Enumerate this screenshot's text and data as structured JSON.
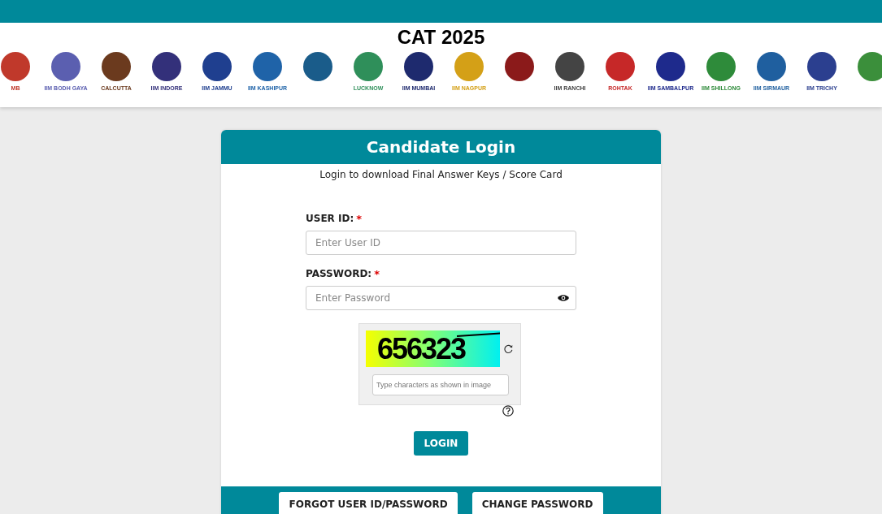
{
  "header": {
    "title": "CAT 2025",
    "logos": [
      {
        "label": "MB",
        "color": "#c0392b"
      },
      {
        "label": "IIM BODH GAYA",
        "color": "#5b5fb0"
      },
      {
        "label": "CALCUTTA",
        "color": "#6b3a1e"
      },
      {
        "label": "IIM INDORE",
        "color": "#33307a"
      },
      {
        "label": "IIM JAMMU",
        "color": "#1f3f8f"
      },
      {
        "label": "IIM KASHIPUR",
        "color": "#1f63a8"
      },
      {
        "color": "#1a5c8a"
      },
      {
        "label": "LUCKNOW",
        "color": "#2f8f5a"
      },
      {
        "label": "IIM MUMBAI",
        "color": "#1e2a6e"
      },
      {
        "label": "IIM NAGPUR",
        "color": "#d4a017"
      },
      {
        "color": "#8b1a1a"
      },
      {
        "label": "IIM RANCHI",
        "color": "#444444"
      },
      {
        "label": "ROHTAK",
        "color": "#c62828"
      },
      {
        "label": "IIM SAMBALPUR",
        "color": "#1e2a8c"
      },
      {
        "label": "IIM SHILLONG",
        "color": "#2e8b3a"
      },
      {
        "label": "IIM SIRMAUR",
        "color": "#1f5f9f"
      },
      {
        "label": "IIM TRICHY",
        "color": "#2b3f8f"
      },
      {
        "color": "#3b8f3b"
      }
    ]
  },
  "login": {
    "title": "Candidate Login",
    "subtitle": "Login to download Final Answer Keys / Score Card",
    "fields": [
      {
        "kind": "text",
        "label": "USER ID:",
        "required_mark": "*",
        "placeholder": "Enter User ID"
      },
      {
        "kind": "password",
        "label": "PASSWORD:",
        "required_mark": "*",
        "placeholder": "Enter Password"
      }
    ],
    "captcha": {
      "code": "656323",
      "placeholder": "Type characters as shown in image"
    },
    "submit": "LOGIN",
    "footer_buttons": [
      "FORGOT USER ID/PASSWORD",
      "CHANGE PASSWORD"
    ]
  }
}
